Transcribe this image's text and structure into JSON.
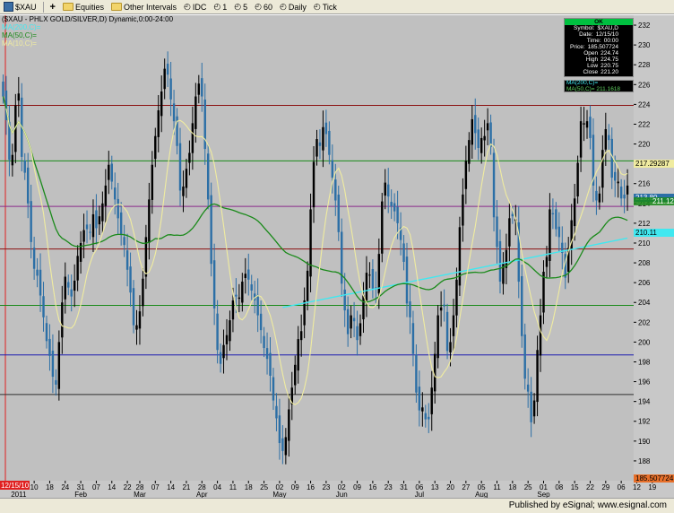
{
  "toolbar": {
    "symbol": "$XAU",
    "equities": "Equities",
    "other_intervals": "Other Intervals",
    "idc": "IDC",
    "i1": "1",
    "i5": "5",
    "i60": "60",
    "daily": "Daily",
    "tick": "Tick"
  },
  "chart_header": {
    "title": "($XAU - PHLX GOLD/SILVER,D) Dynamic,0:00-24:00",
    "legend": [
      "MA(200,C)=",
      "MA(50,C)=",
      "MA(10,C)="
    ]
  },
  "info_box": {
    "status": "OK",
    "rows": [
      {
        "k": "Symbol:",
        "v": "$XAU,D"
      },
      {
        "k": "Date:",
        "v": "12/15/10"
      },
      {
        "k": "Time:",
        "v": "00:00"
      },
      {
        "k": "Price:",
        "v": "185.507724"
      },
      {
        "k": "Open",
        "v": "224.74"
      },
      {
        "k": "High",
        "v": "224.75"
      },
      {
        "k": "Low",
        "v": "220.75"
      },
      {
        "k": "Close",
        "v": "221.20"
      }
    ],
    "ma200": "MA(200,C)=",
    "ma50": "MA(50,C)= 211.1618"
  },
  "price_labels": {
    "ma10": "217.29287",
    "last": "213.80",
    "ma50": "211.12",
    "ma200": "210.11",
    "cursor": "185.507724"
  },
  "cursor_date": "12/15/10",
  "footer": "Published by eSignal; www.esignal.com",
  "colors": {
    "plot_bg": "#c0c0c0",
    "up": "#000000",
    "down": "#2c6fa6",
    "ma10": "#f0eca0",
    "ma50": "#1a8a1a",
    "ma200": "#40e8f0"
  },
  "chart_data": {
    "type": "candlestick",
    "title": "($XAU - PHLX GOLD/SILVER,D) Dynamic,0:00-24:00",
    "y_axis_side": "right",
    "ylim": [
      186,
      233
    ],
    "yticks": [
      188,
      190,
      192,
      194,
      196,
      198,
      200,
      202,
      204,
      206,
      208,
      210,
      212,
      214,
      216,
      218,
      220,
      222,
      224,
      226,
      228,
      230,
      232
    ],
    "x_ticks": [
      {
        "label": "27",
        "pos": 0.5
      },
      {
        "label": "03",
        "pos": 5
      },
      {
        "label": "10",
        "pos": 10
      },
      {
        "label": "18",
        "pos": 15
      },
      {
        "label": "24",
        "pos": 20
      },
      {
        "label": "31",
        "pos": 25
      },
      {
        "label": "07",
        "pos": 30
      },
      {
        "label": "14",
        "pos": 35
      },
      {
        "label": "22",
        "pos": 40
      },
      {
        "label": "28",
        "pos": 44
      },
      {
        "label": "07",
        "pos": 49
      },
      {
        "label": "14",
        "pos": 54
      },
      {
        "label": "21",
        "pos": 59
      },
      {
        "label": "28",
        "pos": 64
      },
      {
        "label": "04",
        "pos": 69
      },
      {
        "label": "11",
        "pos": 74
      },
      {
        "label": "18",
        "pos": 79
      },
      {
        "label": "25",
        "pos": 84
      },
      {
        "label": "02",
        "pos": 89
      },
      {
        "label": "09",
        "pos": 94
      },
      {
        "label": "16",
        "pos": 99
      },
      {
        "label": "23",
        "pos": 104
      },
      {
        "label": "02",
        "pos": 109
      },
      {
        "label": "09",
        "pos": 114
      },
      {
        "label": "16",
        "pos": 119
      },
      {
        "label": "23",
        "pos": 124
      },
      {
        "label": "31",
        "pos": 129
      },
      {
        "label": "06",
        "pos": 134
      },
      {
        "label": "13",
        "pos": 139
      },
      {
        "label": "20",
        "pos": 144
      },
      {
        "label": "27",
        "pos": 149
      },
      {
        "label": "05",
        "pos": 154
      },
      {
        "label": "11",
        "pos": 159
      },
      {
        "label": "18",
        "pos": 164
      },
      {
        "label": "25",
        "pos": 169
      },
      {
        "label": "01",
        "pos": 174
      },
      {
        "label": "08",
        "pos": 179
      },
      {
        "label": "15",
        "pos": 184
      },
      {
        "label": "22",
        "pos": 189
      },
      {
        "label": "29",
        "pos": 194
      },
      {
        "label": "06",
        "pos": 199
      },
      {
        "label": "12",
        "pos": 204
      },
      {
        "label": "19",
        "pos": 209
      }
    ],
    "month_labels": [
      {
        "label": "2011",
        "pos": 5
      },
      {
        "label": "Feb",
        "pos": 25
      },
      {
        "label": "Mar",
        "pos": 44
      },
      {
        "label": "Apr",
        "pos": 64
      },
      {
        "label": "May",
        "pos": 89
      },
      {
        "label": "Jun",
        "pos": 109
      },
      {
        "label": "Jul",
        "pos": 134
      },
      {
        "label": "Aug",
        "pos": 154
      },
      {
        "label": "Sep",
        "pos": 174
      }
    ],
    "hlines": [
      {
        "y": 223.9,
        "color": "#8b1010"
      },
      {
        "y": 218.3,
        "color": "#1a8a1a"
      },
      {
        "y": 213.7,
        "color": "#8a2a8a"
      },
      {
        "y": 209.4,
        "color": "#8b1010"
      },
      {
        "y": 203.7,
        "color": "#1a8a1a"
      },
      {
        "y": 198.7,
        "color": "#1a1ab0"
      },
      {
        "y": 194.7,
        "color": "#303030"
      }
    ],
    "close": [
      224.8,
      222.4,
      218.4,
      218.9,
      223.9,
      225.1,
      218.7,
      217.1,
      214.0,
      210.1,
      207.4,
      206.7,
      204.7,
      202.5,
      200.1,
      198.6,
      196.5,
      195.7,
      200.0,
      204.0,
      206.6,
      205.5,
      204.6,
      206.2,
      208.7,
      210.0,
      211.3,
      211.4,
      211.1,
      212.9,
      211.5,
      212.7,
      214.0,
      215.8,
      217.9,
      216.2,
      214.4,
      212.5,
      210.8,
      209.8,
      207.3,
      205.0,
      201.7,
      201.7,
      203.1,
      206.4,
      210.6,
      214.4,
      217.9,
      220.8,
      223.4,
      225.3,
      227.6,
      227.0,
      224.5,
      222.3,
      219.8,
      215.3,
      215.7,
      217.5,
      219.1,
      222.1,
      224.8,
      226.1,
      224.8,
      219.5,
      214.4,
      207.9,
      203.4,
      199.2,
      197.8,
      199.7,
      200.7,
      202.2,
      204.2,
      204.6,
      204.5,
      206.1,
      206.9,
      206.3,
      205.2,
      204.2,
      202.7,
      201.2,
      199.4,
      198.3,
      196.6,
      194.1,
      192.3,
      189.8,
      189.0,
      190.4,
      193.2,
      195.4,
      197.7,
      200.3,
      201.1,
      204.2,
      207.2,
      213.4,
      218.2,
      220.5,
      219.8,
      221.7,
      221.0,
      218.9,
      216.6,
      214.3,
      211.1,
      205.9,
      203.2,
      200.8,
      202.7,
      202.1,
      200.2,
      201.9,
      204.7,
      207.0,
      206.8,
      205.4,
      205.5,
      208.9,
      214.2,
      216.1,
      214.7,
      213.7,
      213.2,
      212.0,
      210.3,
      208.1,
      203.9,
      202.5,
      198.8,
      194.9,
      193.1,
      193.4,
      192.2,
      192.2,
      195.4,
      198.8,
      202.7,
      203.5,
      203.6,
      199.1,
      200.0,
      202.7,
      206.3,
      211.6,
      214.9,
      218.3,
      220.4,
      222.5,
      221.1,
      219.6,
      220.6,
      220.8,
      222.1,
      219.7,
      212.6,
      209.6,
      206.1,
      208.0,
      209.3,
      212.5,
      212.7,
      212.4,
      206.1,
      200.6,
      196.3,
      195.0,
      191.9,
      194.1,
      199.2,
      202.7,
      207.1,
      208.6,
      213.4,
      212.9,
      211.4,
      210.6,
      209.0,
      206.5,
      209.5,
      212.3,
      214.5,
      218.1,
      222.3,
      222.1,
      222.3,
      220.6,
      215.8,
      214.3,
      215.0,
      219.4,
      221.5,
      220.4,
      216.6,
      216.3,
      216.2,
      214.5,
      214.5,
      215.8
    ],
    "ma50_start": 0,
    "ma200_start": 90
  }
}
